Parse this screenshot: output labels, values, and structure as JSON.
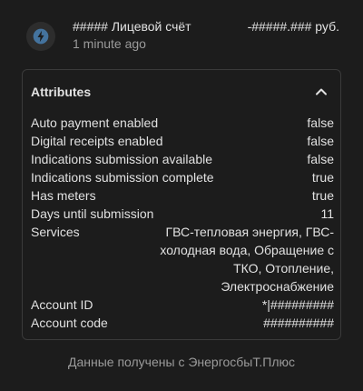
{
  "entity": {
    "icon": "lightning-bolt-icon",
    "name": "##### Лицевой счёт",
    "age": "1 minute ago",
    "state": "-#####.### руб."
  },
  "attributes": {
    "title": "Attributes",
    "toggle_icon": "chevron-up-icon",
    "rows": [
      {
        "key": "Auto payment enabled",
        "value": "false"
      },
      {
        "key": "Digital receipts enabled",
        "value": "false"
      },
      {
        "key": "Indications submission available",
        "value": "false"
      },
      {
        "key": "Indications submission complete",
        "value": "true"
      },
      {
        "key": "Has meters",
        "value": "true"
      },
      {
        "key": "Days until submission",
        "value": "11"
      },
      {
        "key": "Services",
        "value": "ГВС-тепловая энергия, ГВС-холодная вода, Обращение с ТКО, Отопление, Электроснабжение"
      },
      {
        "key": "Account ID",
        "value": "*|#########"
      },
      {
        "key": "Account code",
        "value": "##########"
      }
    ]
  },
  "footer": {
    "attribution": "Данные получены с ЭнергосбыТ.Плюс"
  },
  "colors": {
    "background": "#1c1c1c",
    "icon_accent": "#44739e",
    "border": "#3a3a3a",
    "secondary_text": "#9b9b9b"
  }
}
